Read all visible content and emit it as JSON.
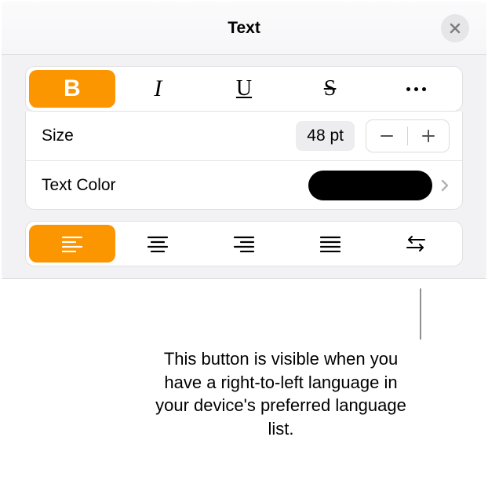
{
  "header": {
    "title": "Text"
  },
  "styleBar": {
    "bold": "B",
    "italic": "I",
    "underline": "U",
    "strike": "S"
  },
  "sizeRow": {
    "label": "Size",
    "value": "48 pt"
  },
  "colorRow": {
    "label": "Text Color",
    "swatch": "#000000"
  },
  "callout": "This button is visible when you have a right-to-left language in your device's preferred language list."
}
